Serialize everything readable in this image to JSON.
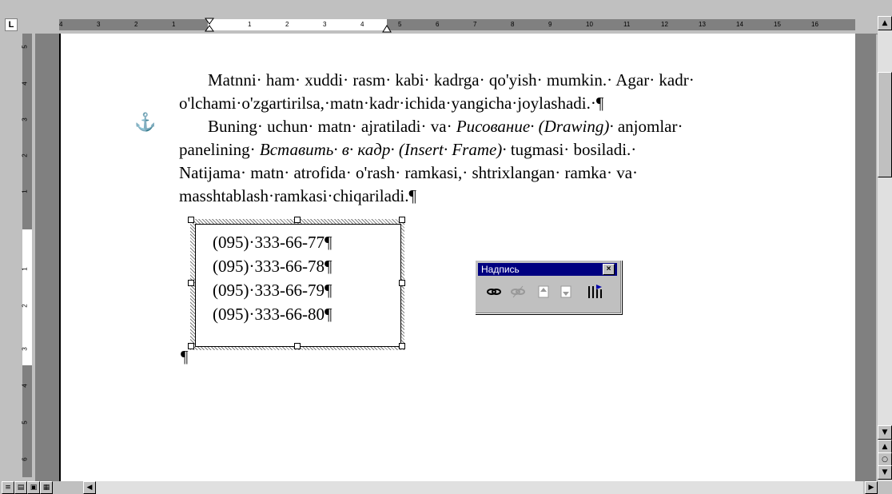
{
  "ruler": {
    "corner_label": "L",
    "h_numbers": [
      "4",
      "3",
      "2",
      "1",
      "1",
      "2",
      "3",
      "4",
      "5",
      "6",
      "7",
      "8",
      "9",
      "10",
      "11",
      "12",
      "13",
      "14",
      "15",
      "16"
    ],
    "v_numbers": [
      "5",
      "4",
      "3",
      "2",
      "1",
      "1",
      "2",
      "3",
      "4",
      "5",
      "6"
    ]
  },
  "document": {
    "para1_line1": "Matnni· ham· xuddi· rasm· kabi· kadrga· qo'yish· mumkin.· Agar· kadr·",
    "para1_line2": "o'lchami·o'zgartirilsa,·matn·kadr·ichida·yangicha·joylashadi.·¶",
    "para2_line1_a": "Buning· uchun· matn· ajratiladi· va·",
    "para2_line1_italic": "Рисование· (Drawing)·",
    "para2_line1_b": "anjomlar·",
    "para2_line2_a": "panelining·",
    "para2_line2_italic": "Вставить· в· кадр· (Insert· Frame)·",
    "para2_line2_b": "tugmasi· bosiladi.·",
    "para2_line3": "Natijama· matn· atrofida· o'rash· ramkasi,· shtrixlangan· ramka· va·",
    "para2_line4": "masshtablash·ramkasi·chiqariladi.¶",
    "anchor_symbol": "⚓",
    "end_mark": "¶"
  },
  "frame": {
    "phones": [
      "(095)·333-66-77¶",
      "(095)·333-66-78¶",
      "(095)·333-66-79¶",
      "(095)·333-66-80¶"
    ]
  },
  "toolbar": {
    "title": "Надпись",
    "close_label": "×",
    "icons": [
      "link-icon",
      "unlink-icon",
      "previous-textbox-icon",
      "next-textbox-icon",
      "text-direction-icon"
    ]
  },
  "view_buttons": [
    "normal-view",
    "web-layout-view",
    "print-layout-view",
    "outline-view"
  ]
}
